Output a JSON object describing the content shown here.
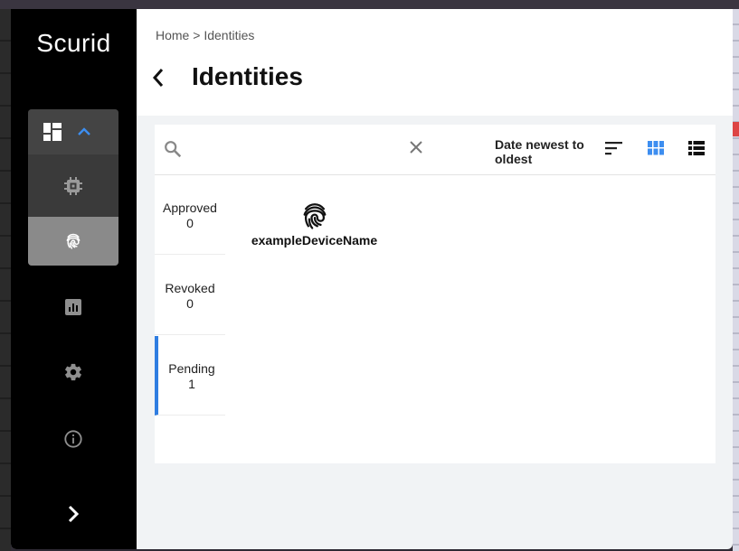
{
  "app": {
    "name": "Scurid"
  },
  "sidebar": {
    "items": [
      {
        "id": "dashboard",
        "icon": "dashboard-icon"
      },
      {
        "id": "devices",
        "icon": "chip-icon"
      },
      {
        "id": "identities",
        "icon": "fingerprint-icon",
        "active": true
      },
      {
        "id": "reports",
        "icon": "chart-icon"
      },
      {
        "id": "settings",
        "icon": "gear-icon"
      },
      {
        "id": "info",
        "icon": "info-icon"
      }
    ],
    "expand_icon": "chevron-right-icon"
  },
  "header": {
    "breadcrumb": {
      "home": "Home",
      "separator": " > ",
      "current": "Identities"
    },
    "title": "Identities"
  },
  "toolbar": {
    "search": {
      "value": "",
      "placeholder": ""
    },
    "sort_label": "Date newest to oldest",
    "view_mode": "grid"
  },
  "tabs": [
    {
      "label": "Approved",
      "count": "0"
    },
    {
      "label": "Revoked",
      "count": "0"
    },
    {
      "label": "Pending",
      "count": "1",
      "active": true
    }
  ],
  "devices": [
    {
      "name": "exampleDeviceName",
      "icon": "fingerprint-icon"
    }
  ],
  "colors": {
    "accent": "#2f7de1",
    "sidebar": "#000000",
    "active_nav": "#8a8a8a"
  }
}
